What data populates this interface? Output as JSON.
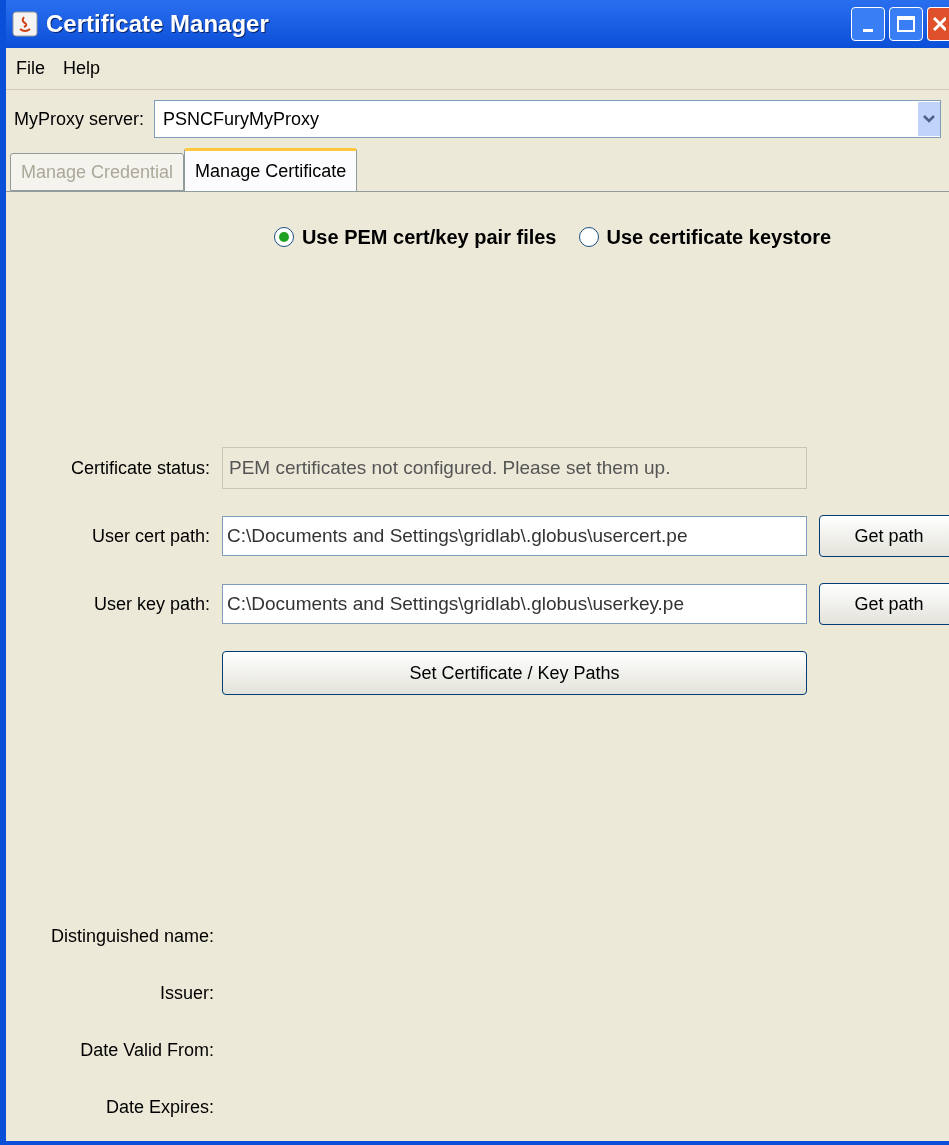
{
  "window": {
    "title": "Certificate Manager"
  },
  "menu": [
    "File",
    "Help"
  ],
  "server": {
    "label": "MyProxy server:",
    "value": "PSNCFuryMyProxy"
  },
  "tabs": [
    {
      "label": "Manage Credential",
      "selected": false,
      "disabled": true
    },
    {
      "label": "Manage Certificate",
      "selected": true,
      "disabled": false
    }
  ],
  "radios": [
    {
      "label": "Use PEM cert/key pair files",
      "selected": true
    },
    {
      "label": "Use certificate keystore",
      "selected": false
    }
  ],
  "status": {
    "label": "Certificate status:",
    "value": "PEM certificates not configured. Please set them up."
  },
  "paths": [
    {
      "label": "User cert path:",
      "value": "C:\\Documents and Settings\\gridlab\\.globus\\usercert.pe",
      "button": "Get path"
    },
    {
      "label": "User key path:",
      "value": "C:\\Documents and Settings\\gridlab\\.globus\\userkey.pe",
      "button": "Get path"
    }
  ],
  "set_button": "Set Certificate / Key Paths",
  "details": [
    "Distinguished name:",
    "Issuer:",
    "Date Valid From:",
    "Date Expires:"
  ]
}
